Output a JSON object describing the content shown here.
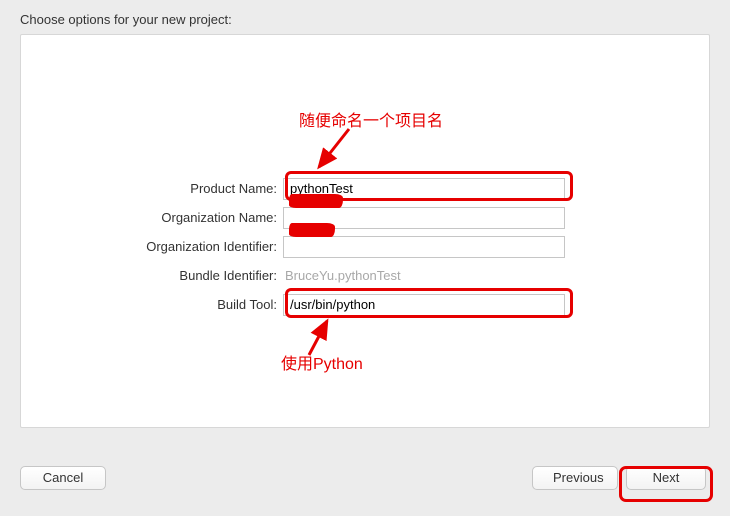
{
  "heading": "Choose options for your new project:",
  "form": {
    "productName": {
      "label": "Product Name:",
      "value": "pythonTest"
    },
    "organizationName": {
      "label": "Organization Name:",
      "value": ""
    },
    "organizationId": {
      "label": "Organization Identifier:",
      "value": ""
    },
    "bundleId": {
      "label": "Bundle Identifier:",
      "value": "BruceYu.pythonTest"
    },
    "buildTool": {
      "label": "Build Tool:",
      "value": "/usr/bin/python"
    }
  },
  "annotations": {
    "productName": "随便命名一个项目名",
    "buildTool": "使用Python"
  },
  "buttons": {
    "cancel": "Cancel",
    "previous": "Previous",
    "next": "Next"
  },
  "colors": {
    "annotation": "#e60000"
  }
}
